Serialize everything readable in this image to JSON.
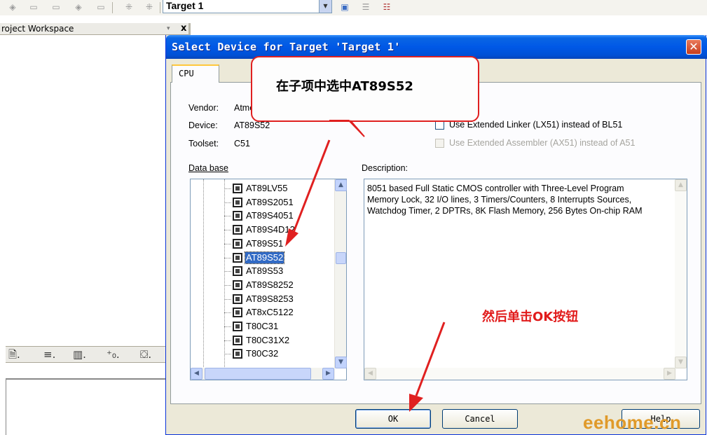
{
  "ide": {
    "target_name": "Target 1",
    "workspace_title": "roject Workspace",
    "workspace_close": "x"
  },
  "dialog": {
    "title": "Select Device for Target 'Target 1'",
    "close_glyph": "✕",
    "tab_cpu": "CPU",
    "vendor_label": "Vendor:",
    "vendor_value": "Atme",
    "device_label": "Device:",
    "device_value": "AT89S52",
    "toolset_label": "Toolset:",
    "toolset_value": "C51",
    "ext_linker_label": "Use Extended Linker (LX51) instead of BL51",
    "ext_assembler_label": "Use Extended Assembler (AX51) instead of A51",
    "database_label": "Data base",
    "description_label": "Description:",
    "description_text": "8051 based Full Static CMOS controller with Three-Level Program\nMemory Lock, 32 I/O lines, 3 Timers/Counters, 8 Interrupts Sources,\nWatchdog Timer, 2 DPTRs, 8K Flash Memory, 256 Bytes On-chip RAM",
    "devices": [
      "AT89LV55",
      "AT89S2051",
      "AT89S4051",
      "AT89S4D12",
      "AT89S51",
      "AT89S52",
      "AT89S53",
      "AT89S8252",
      "AT89S8253",
      "AT8xC5122",
      "T80C31",
      "T80C31X2",
      "T80C32"
    ],
    "selected_device": "AT89S52",
    "ok_label": "OK",
    "cancel_label": "Cancel",
    "help_label": "Help"
  },
  "annotations": {
    "callout_text": "在子项中选中AT89S52",
    "note_text": "然后单击OK按钮",
    "watermark": "eehome.cn",
    "accent_color": "#e02020"
  }
}
